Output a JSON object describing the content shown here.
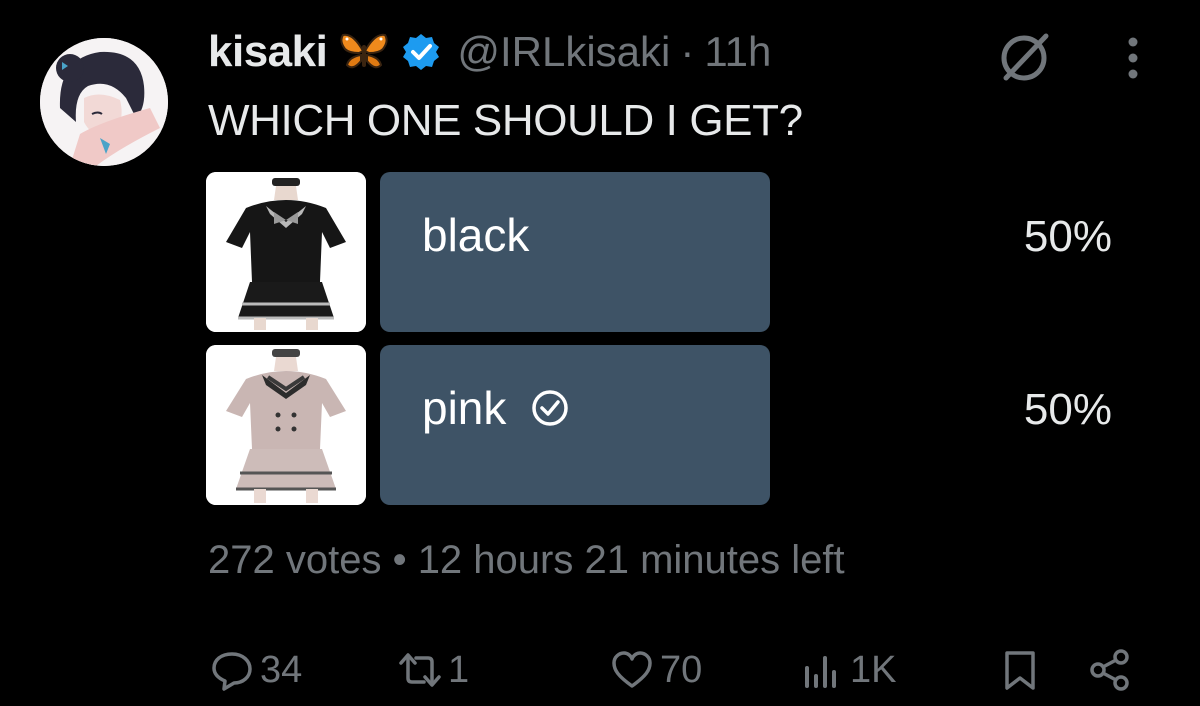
{
  "author": {
    "name": "kisaki",
    "emoji_icon": "butterfly-emoji",
    "verified_icon": "verified-badge-icon",
    "handle": "@IRLkisaki",
    "separator": "·",
    "time": "11h"
  },
  "tweet": {
    "text": "WHICH ONE SHOULD I GET?"
  },
  "poll": {
    "options": [
      {
        "label": "black",
        "percent": "50%",
        "percent_value": 50,
        "image_icon": "black-dress-image",
        "selected": false
      },
      {
        "label": "pink",
        "percent": "50%",
        "percent_value": 50,
        "image_icon": "pink-dress-image",
        "selected": true
      }
    ],
    "meta": "272 votes • 12 hours 21 minutes left"
  },
  "actions": {
    "reply_count": "34",
    "retweet_count": "1",
    "like_count": "70",
    "views_count": "1K"
  },
  "colors": {
    "background": "#000000",
    "text": "#e7e9ea",
    "secondary": "#71767b",
    "poll_bar": "#3e5366",
    "verified": "#1d9bf0"
  }
}
